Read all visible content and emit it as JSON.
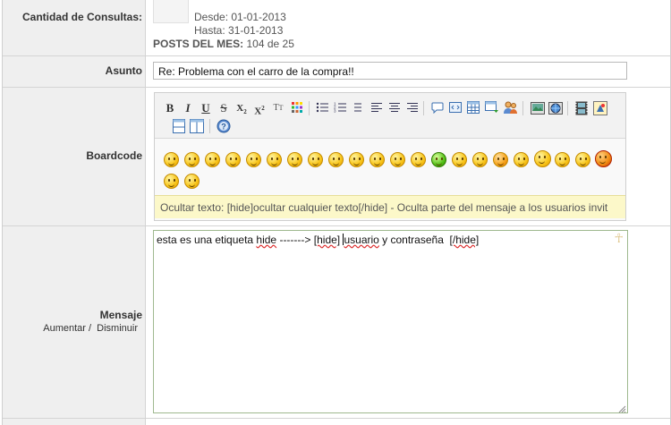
{
  "consultas": {
    "label": "Cantidad de Consultas:",
    "desde": "Desde: 01-01-2013",
    "hasta": "Hasta: 31-01-2013",
    "posts_label": "POSTS DEL MES:",
    "posts_value": "104 de 25"
  },
  "asunto": {
    "label": "Asunto",
    "value": "Re: Problema con el carro de la compra!!"
  },
  "boardcode": {
    "label": "Boardcode",
    "toolbar": [
      {
        "name": "bold-button",
        "icon": "bold-icon",
        "glyph": "B"
      },
      {
        "name": "italic-button",
        "icon": "italic-icon",
        "glyph": "I"
      },
      {
        "name": "underline-button",
        "icon": "underline-icon",
        "glyph": "U"
      },
      {
        "name": "strike-button",
        "icon": "strikethrough-icon",
        "glyph": "S"
      },
      {
        "name": "subscript-button",
        "icon": "subscript-icon",
        "glyph": "X₂"
      },
      {
        "name": "superscript-button",
        "icon": "superscript-icon",
        "glyph": "X²"
      },
      {
        "name": "font-size-button",
        "icon": "font-size-icon",
        "glyph": "TT"
      },
      {
        "name": "color-button",
        "icon": "color-grid-icon",
        "glyph": "▦"
      },
      {
        "name": "bullet-list-button",
        "icon": "bullet-list-icon",
        "glyph": "☰"
      },
      {
        "name": "numbered-list-button",
        "icon": "numbered-list-icon",
        "glyph": "☷"
      },
      {
        "name": "list-button",
        "icon": "list-icon",
        "glyph": "≡"
      },
      {
        "name": "align-left-button",
        "icon": "align-left-icon",
        "glyph": "≣"
      },
      {
        "name": "align-center-button",
        "icon": "align-center-icon",
        "glyph": "≣"
      },
      {
        "name": "align-right-button",
        "icon": "align-right-icon",
        "glyph": "≣"
      },
      {
        "name": "quote-button",
        "icon": "speech-bubble-icon",
        "glyph": "💬"
      },
      {
        "name": "code-button",
        "icon": "code-icon",
        "glyph": "⟨⟩"
      },
      {
        "name": "table-button",
        "icon": "table-icon",
        "glyph": "▤"
      },
      {
        "name": "spoiler-button",
        "icon": "window-arrow-icon",
        "glyph": "▭"
      },
      {
        "name": "users-button",
        "icon": "users-icon",
        "glyph": "👥"
      },
      {
        "name": "image-button",
        "icon": "image-icon",
        "glyph": "🖼"
      },
      {
        "name": "link-button",
        "icon": "globe-link-icon",
        "glyph": "🌐"
      },
      {
        "name": "video-button",
        "icon": "film-icon",
        "glyph": "🎞"
      },
      {
        "name": "flash-button",
        "icon": "flash-icon",
        "glyph": "⚡"
      },
      {
        "name": "hr-button",
        "icon": "horizontal-split-icon",
        "glyph": "⊟"
      },
      {
        "name": "columns-button",
        "icon": "columns-icon",
        "glyph": "◫"
      },
      {
        "name": "help-button",
        "icon": "help-icon",
        "glyph": "?"
      }
    ],
    "smileys_count": 24,
    "hint": "Ocultar texto: [hide]ocultar cualquier texto[/hide] - Oculta parte del mensaje a los usuarios invit"
  },
  "mensaje": {
    "label": "Mensaje",
    "aumentar": "Aumentar",
    "separator": "/",
    "disminuir": "Disminuir",
    "text_part1": "esta es una etiqueta ",
    "text_hide": "hide",
    "text_part2": " -------> ",
    "text_tag_open": "[hide]",
    "text_part3": " ",
    "text_usuario": "usuario",
    "text_part4": " y ",
    "text_contrasena": "contraseña",
    "text_part5": "  ",
    "text_tag_close": "[/hide]"
  },
  "colors": {
    "label_bg": "#efefef",
    "hint_bg": "#fcf8c9",
    "message_border": "#9fb98f"
  }
}
